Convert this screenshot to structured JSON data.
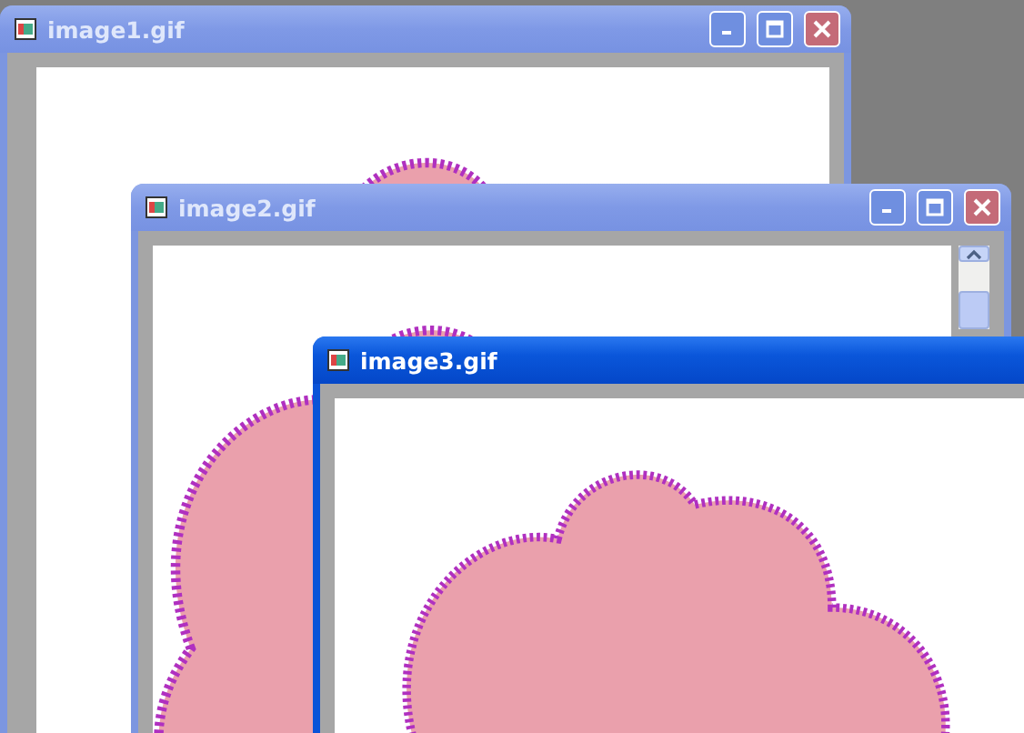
{
  "windows": [
    {
      "title": "image1.gif",
      "active": false,
      "buttons": true,
      "scrollbar": false
    },
    {
      "title": "image2.gif",
      "active": false,
      "buttons": true,
      "scrollbar": true
    },
    {
      "title": "image3.gif",
      "active": true,
      "buttons": false,
      "scrollbar": false
    }
  ]
}
